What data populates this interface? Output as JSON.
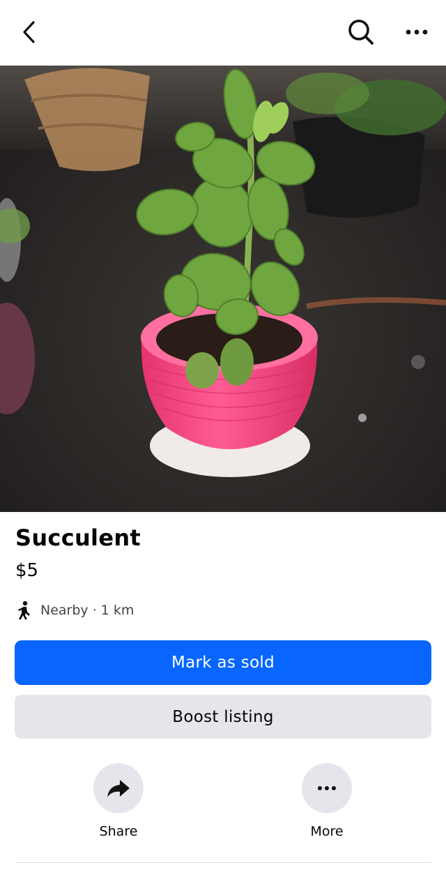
{
  "header": {
    "back_icon": "chevron-left-icon",
    "search_icon": "search-icon",
    "menu_icon": "more-horizontal-icon"
  },
  "listing": {
    "photo_alt": "Succulent in pink pot",
    "title": "Succulent",
    "price": "$5",
    "distance_icon": "walking-person-icon",
    "distance_text": "Nearby · 1 km"
  },
  "buttons": {
    "mark_sold": "Mark as sold",
    "boost": "Boost listing"
  },
  "actions": [
    {
      "label": "Share",
      "icon": "share-arrow-icon"
    },
    {
      "label": "More",
      "icon": "more-horizontal-icon"
    }
  ],
  "colors": {
    "primary": "#0866ff",
    "secondary_bg": "#e4e6eb",
    "text": "#050505"
  }
}
